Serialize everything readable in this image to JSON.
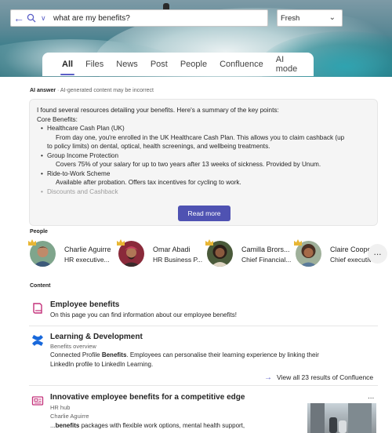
{
  "search": {
    "query": "what are my benefits?",
    "filter": "Fresh"
  },
  "tabs": [
    "All",
    "Files",
    "News",
    "Post",
    "People",
    "Confluence",
    "AI mode"
  ],
  "ai": {
    "label": "AI answer",
    "disclaimer": "AI-generated content may be incorrect",
    "intro": "I found several resources detailing your benefits. Here's a summary of the key points:",
    "section": "Core Benefits:",
    "items": [
      {
        "title": "Healthcare Cash Plan (UK)",
        "desc1": "From day one, you're enrolled in the UK Healthcare Cash Plan. This allows you to claim cashback (up",
        "desc2": "to policy limits) on dental, optical, health screenings, and wellbeing treatments."
      },
      {
        "title": "Group Income Protection",
        "desc1": "Covers 75% of your salary for up to two years after 13 weeks of sickness. Provided by Unum."
      },
      {
        "title": "Ride-to-Work Scheme",
        "desc1": "Available after probation. Offers tax incentives for cycling to work."
      },
      {
        "title": "Discounts and Cashback"
      }
    ],
    "read_more": "Read more"
  },
  "people": {
    "label": "People",
    "list": [
      {
        "name": "Charlie Aguirre",
        "title": "HR executive..."
      },
      {
        "name": "Omar Abadi",
        "title": "HR Business P..."
      },
      {
        "name": "Camilla Brors...",
        "title": "Chief Financial..."
      },
      {
        "name": "Claire Cooper",
        "title": "Chief executiv..."
      }
    ],
    "more": "..."
  },
  "content": {
    "label": "Content",
    "r1": {
      "title": "Employee benefits",
      "line": "On this page you can find information about our employee benefits!"
    },
    "r2": {
      "title": "Learning & Development",
      "sub": "Benefits overview",
      "line1_pre": "Connected Profile ",
      "line1_bold": "Benefits",
      "line1_post": ". Employees can personalise their learning experience by linking their",
      "line2": "LinkedIn profile to LinkedIn Learning."
    },
    "view_all": "View all 23 results of Confluence",
    "r3": {
      "title": "Innovative employee benefits for a competitive edge",
      "site": "HR hub",
      "author": "Charlie Aguirre",
      "snip_pre": "...",
      "snip_bold": "benefits",
      "snip_post": " packages with flexible work options, mental health support,"
    },
    "more": "..."
  },
  "colors": {
    "accent": "#5b5fc7",
    "button": "#4f52b2"
  }
}
